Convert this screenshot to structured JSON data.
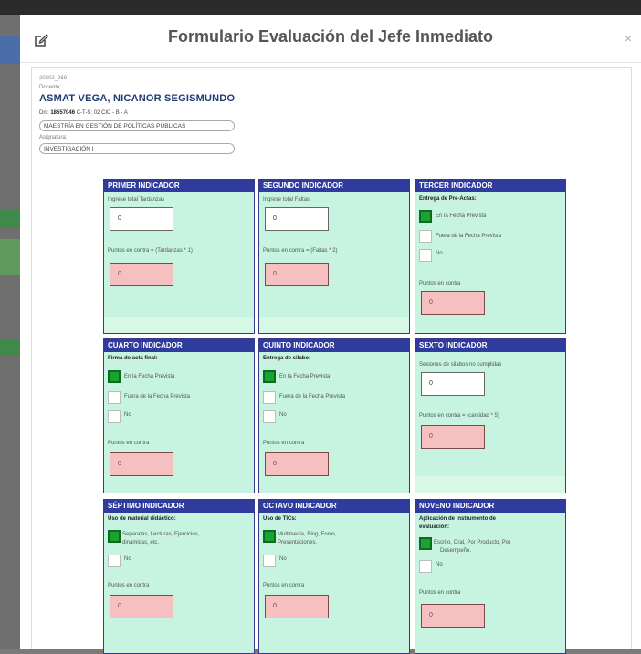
{
  "modal": {
    "title": "Formulario Evaluación del Jefe Inmediato",
    "close": "×",
    "edit_icon": "edit-icon"
  },
  "docente": {
    "code": "20202_269",
    "label": "Docente:",
    "name": "ASMAT VEGA, NICANOR SEGISMUNDO",
    "dni_label": "Dni:",
    "dni": "18557046",
    "cts": "C-T-S: 02 CIC - B - A",
    "program": "MAESTRÍA EN GESTIÓN DE POLÍTICAS PÚBLICAS",
    "asig_label": "Asignatura:",
    "asignatura": "INVESTIGACIÓN I"
  },
  "cards": {
    "c1": {
      "title": "PRIMER INDICADOR",
      "prompt": "Ingrese total Tardanzas",
      "value": "0",
      "formula": "Puntos en contra = (Tardanzas * 1)",
      "points": "0"
    },
    "c2": {
      "title": "SEGUNDO INDICADOR",
      "prompt": "Ingrese total Faltas",
      "value": "0",
      "formula": "Puntos en contra = (Faltas * 2)",
      "points": "0"
    },
    "c3": {
      "title": "TERCER INDICADOR",
      "question": "Entrega de Pre-Actas:",
      "opt1": "En la Fecha Prevista",
      "opt2": "Fuera de la Fecha Prevista",
      "opt3": "No",
      "contra": "Puntos en contra",
      "points": "0"
    },
    "c4": {
      "title": "CUARTO INDICADOR",
      "question": "Firma de acta final:",
      "opt1": "En la Fecha Prevista",
      "opt2": "Fuera de la Fecha Prevista",
      "opt3": "No",
      "contra": "Puntos en contra",
      "points": "0"
    },
    "c5": {
      "title": "QUINTO INDICADOR",
      "question": "Entrega de silabo:",
      "opt1": "En la Fecha Prevista",
      "opt2": "Fuera de la Fecha Prevista",
      "opt3": "No",
      "contra": "Puntos en contra",
      "points": "0"
    },
    "c6": {
      "title": "SEXTO INDICADOR",
      "prompt": "Sesiones de silabos no cumplidas",
      "value": "0",
      "formula": "Puntos en contra = (cantidad * 5)",
      "points": "0"
    },
    "c7": {
      "title": "SÉPTIMO INDICADOR",
      "question": "Uso de material didáctico:",
      "opt1a": "Separatas, Lecturas, Ejercicios,",
      "opt1b": "dinámicas, etc.",
      "opt3": "No",
      "contra": "Puntos en contra",
      "points": "0"
    },
    "c8": {
      "title": "OCTAVO INDICADOR",
      "question": "Uso de TICs:",
      "opt1a": "Multimedia, Blog, Foros,",
      "opt1b": "Presentaciones.",
      "opt3": "No",
      "contra": "Puntos en contra",
      "points": "0"
    },
    "c9": {
      "title": "NOVENO INDICADOR",
      "question_a": "Aplicación de instrumento de",
      "question_b": "evaluación:",
      "opt1a": "Escrito, Oral, Por Producto, Por",
      "opt1b": "Desempeño.",
      "opt3": "No",
      "contra": "Puntos en contra",
      "points": "0"
    }
  },
  "colors": {
    "card_bg": "#c6f4e0",
    "card_header": "#2f3c9e",
    "checked": "#1aa332",
    "points_bg": "#f6c0c0",
    "name": "#1f3a73"
  }
}
